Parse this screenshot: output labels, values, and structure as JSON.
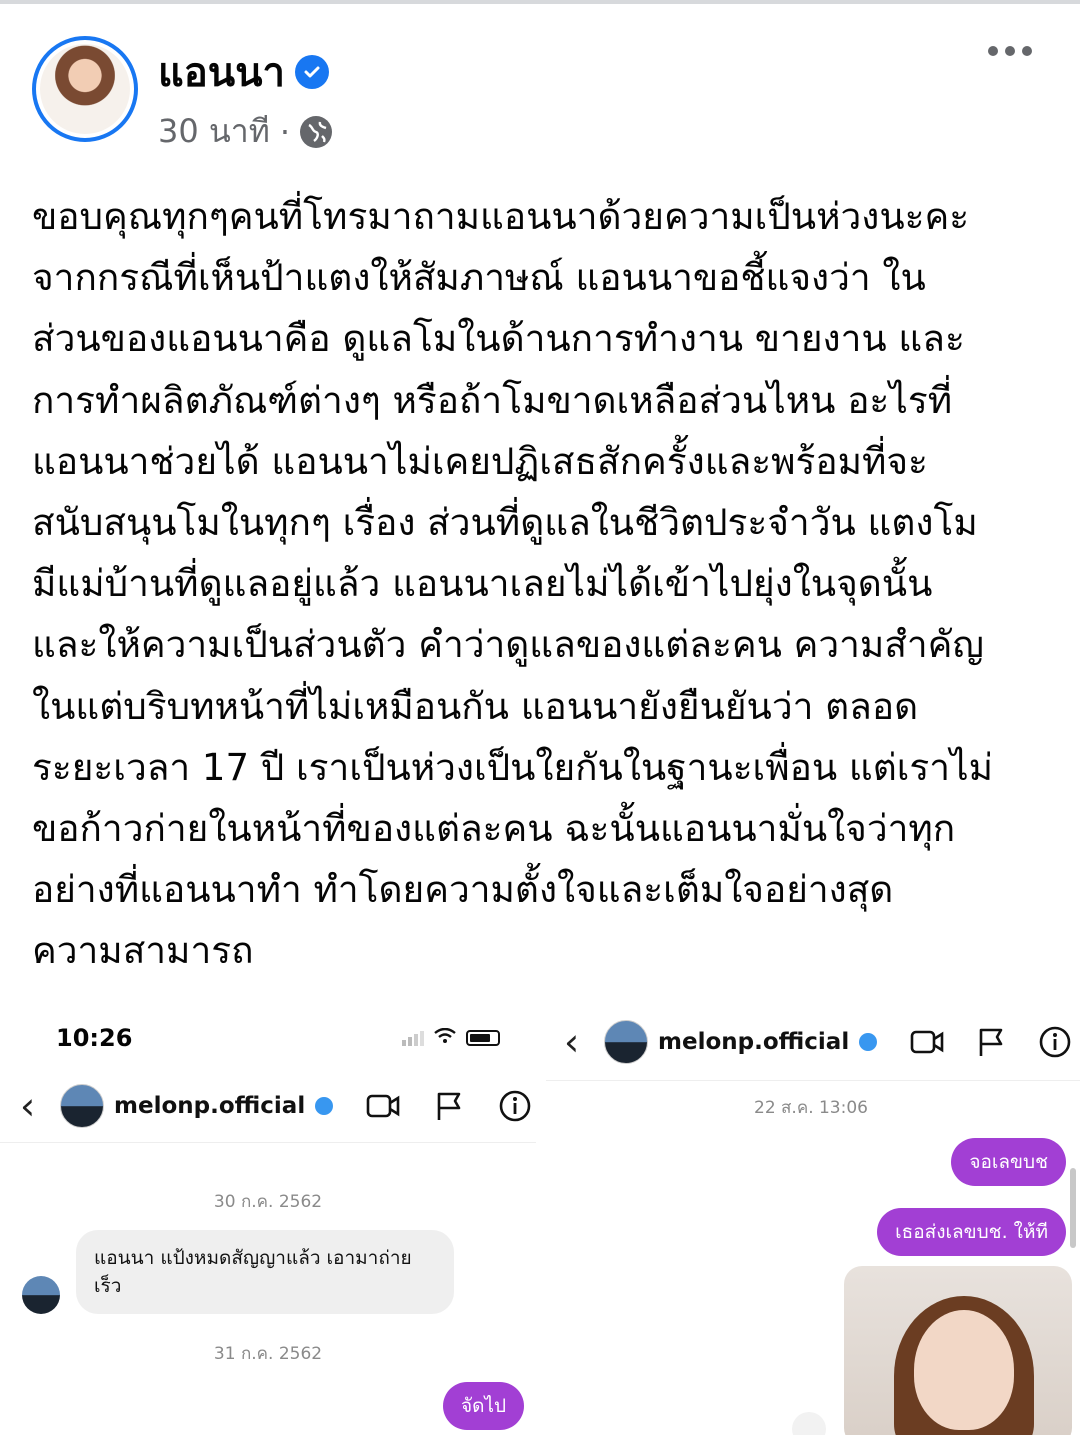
{
  "post": {
    "author": "แอนนา",
    "time": "30 นาที",
    "separator": "·",
    "lines": [
      "ขอบคุณทุกๆคนที่โทรมาถามแอนนาด้วยความเป็นห่วงนะคะ",
      "จากกรณีที่เห็นป้าแตงให้สัมภาษณ์ แอนนาขอชี้แจงว่า ใน",
      "ส่วนของแอนนาคือ ดูแลโมในด้านการทำงาน ขายงาน และ",
      "การทำผลิตภัณฑ์ต่างๆ หรือถ้าโมขาดเหลือส่วนไหน อะไรที่",
      "แอนนาช่วยได้ แอนนาไม่เคยปฏิเสธสักครั้งและพร้อมที่จะ",
      "สนับสนุนโมในทุกๆ เรื่อง ส่วนที่ดูแลในชีวิตประจำวัน แตงโม",
      "มีแม่บ้านที่ดูแลอยู่แล้ว แอนนาเลยไม่ได้เข้าไปยุ่งในจุดนั้น",
      "และให้ความเป็นส่วนตัว คำว่าดูแลของแต่ละคน ความสำคัญ",
      "ในแต่บริบทหน้าที่ไม่เหมือนกัน แอนนายังยืนยันว่า ตลอด",
      "ระยะเวลา 17 ปี เราเป็นห่วงเป็นใยกันในฐานะเพื่อน แต่เราไม่",
      "ขอก้าวก่ายในหน้าที่ของแต่ละคน ฉะนั้นแอนนามั่นใจว่าทุก",
      "อย่างที่แอนนาทำ ทำโดยความตั้งใจและเต็มใจอย่างสุด",
      "ความสามารถ"
    ]
  },
  "left_chat": {
    "status_time": "10:26",
    "username": "melonp.official",
    "date1": "30 ก.ค. 2562",
    "incoming_message": "แอนนา แป้งหมดสัญญาแล้ว เอามาถ่ายเร็ว",
    "date2": "31 ก.ค. 2562",
    "outgoing_message": "จัดไป"
  },
  "right_chat": {
    "username": "melonp.official",
    "date": "22 ส.ค. 13:06",
    "outgoing_1": "จอเลขบช",
    "outgoing_2": "เธอส่งเลขบช. ให้ที"
  },
  "colors": {
    "accent": "#1877f2",
    "bubble_out": "#a23fd4"
  }
}
